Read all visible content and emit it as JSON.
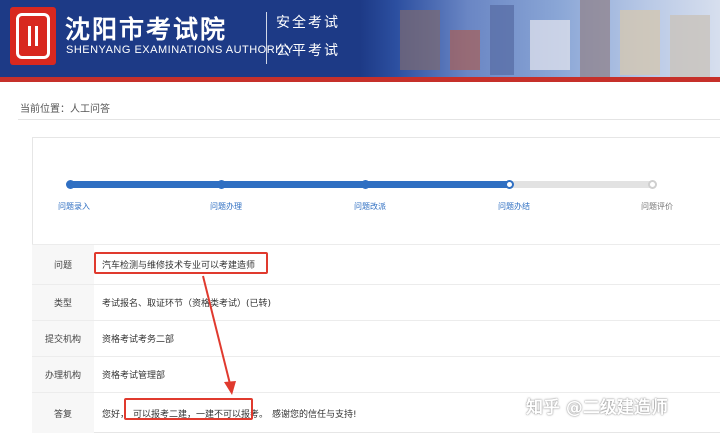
{
  "header": {
    "title": "沈阳市考试院",
    "subtitle": "SHENYANG EXAMINATIONS AUTHORITY",
    "slogan_line1": "安全考试",
    "slogan_line2": "公平考试",
    "logo_icon": "exam-seal-logo-icon",
    "colors": {
      "banner": "#1d3a86",
      "logo": "#d8281f",
      "strip": "#c6302a"
    }
  },
  "breadcrumb": {
    "label": "当前位置：",
    "current": "人工问答"
  },
  "progress": {
    "steps": [
      {
        "label": "问题录入",
        "state": "done"
      },
      {
        "label": "问题办理",
        "state": "done"
      },
      {
        "label": "问题改派",
        "state": "done"
      },
      {
        "label": "问题办结",
        "state": "current"
      },
      {
        "label": "问题评价",
        "state": "todo"
      }
    ],
    "accent": "#2f6fc2"
  },
  "details": {
    "question_label": "问题",
    "question_value": "汽车检测与维修技术专业可以考建造师",
    "type_label": "类型",
    "type_value": "考试报名、取证环节（资格类考试）(已转)",
    "submit_org_label": "提交机构",
    "submit_org_value": "资格考试考务二部",
    "handle_org_label": "办理机构",
    "handle_org_value": "资格考试管理部",
    "answer_label": "答复",
    "answer_prefix": "您好，",
    "answer_highlight": "可以报考二建，一建不可以报考。",
    "answer_suffix": "感谢您的信任与支持!"
  },
  "annotation": {
    "color": "#e03a2e"
  },
  "watermark": "知乎 @二级建造师"
}
